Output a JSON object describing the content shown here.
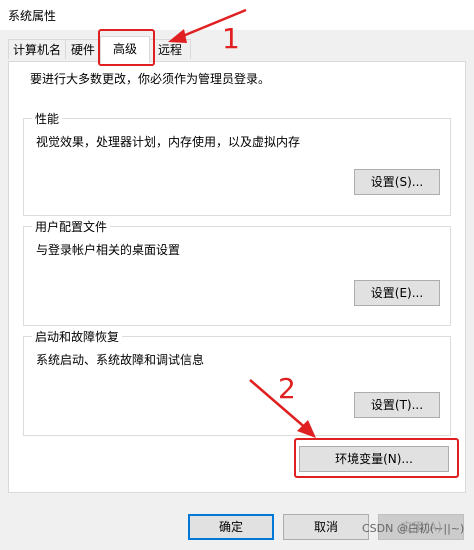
{
  "window": {
    "title": "系统属性"
  },
  "tabs": [
    {
      "label": "计算机名"
    },
    {
      "label": "硬件"
    },
    {
      "label": "高级"
    },
    {
      "label": "远程"
    }
  ],
  "notice": "要进行大多数更改，你必须作为管理员登录。",
  "groups": {
    "performance": {
      "title": "性能",
      "desc": "视觉效果，处理器计划，内存使用，以及虚拟内存",
      "button": "设置(S)..."
    },
    "profiles": {
      "title": "用户配置文件",
      "desc": "与登录帐户相关的桌面设置",
      "button": "设置(E)..."
    },
    "startup": {
      "title": "启动和故障恢复",
      "desc": "系统启动、系统故障和调试信息",
      "button": "设置(T)..."
    }
  },
  "env_button": "环境变量(N)...",
  "footer": {
    "ok": "确定",
    "cancel": "取消",
    "apply": "应用(A)"
  },
  "annotations": {
    "step1": "1",
    "step2": "2",
    "color": "#e02020"
  },
  "watermark": "CSDN @白初(~||~)"
}
